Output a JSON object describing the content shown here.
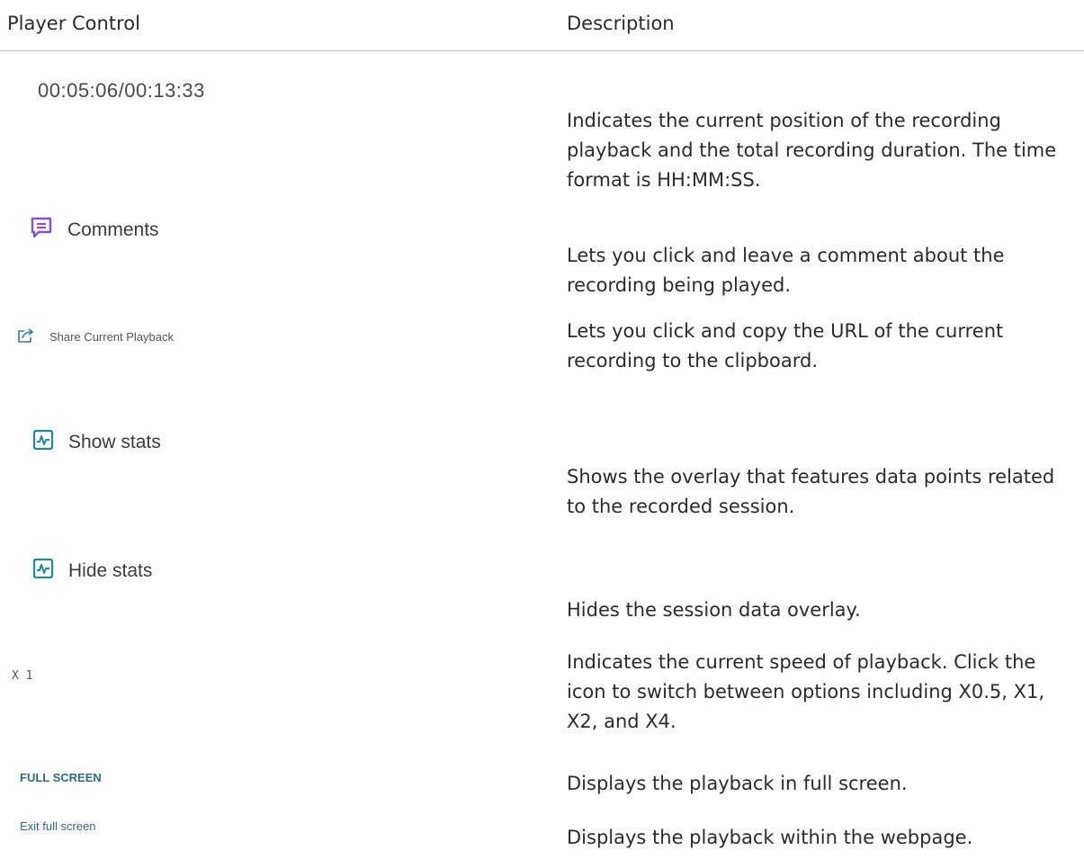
{
  "table": {
    "header": {
      "control": "Player Control",
      "description": "Description"
    },
    "rows": [
      {
        "control": "00:05:06/00:13:33",
        "icon": null,
        "description": "Indicates the current position of the recording playback and the total recording duration. The time format is HH:MM:SS."
      },
      {
        "control": "Comments",
        "icon": "comment-icon",
        "icon_color": "#8a4fd6",
        "description": "Lets you click and leave a comment about the recording being played."
      },
      {
        "control": "Share Current Playback",
        "icon": "share-icon",
        "icon_color": "#2a7fa8",
        "description": "Lets you click and copy the URL of the current recording to the clipboard."
      },
      {
        "control": "Show stats",
        "icon": "stats-icon",
        "icon_color": "#1f8a99",
        "description": "Shows the overlay that features data points related to the recorded session."
      },
      {
        "control": "Hide stats",
        "icon": "stats-icon",
        "icon_color": "#1f8a99",
        "description": "Hides the session data overlay."
      },
      {
        "control": "X 1",
        "icon": null,
        "description": "Indicates the current speed of playback. Click the icon to switch between options including X0.5, X1, X2, and X4."
      },
      {
        "control": "FULL SCREEN",
        "icon": null,
        "description": "Displays the playback in full screen."
      },
      {
        "control": "Exit full screen",
        "icon": null,
        "description": "Displays the playback within the webpage."
      }
    ]
  }
}
